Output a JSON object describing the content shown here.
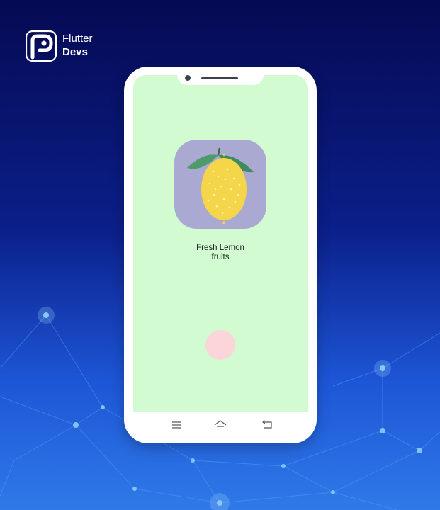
{
  "brand": {
    "line1": "Flutter",
    "line2": "Devs",
    "logo_icon": "flutterdevs-logo-icon"
  },
  "app": {
    "image_icon": "lemon-icon",
    "caption_line1": "Fresh Lemon",
    "caption_line2": "fruits",
    "button_icon": "circle-button-icon"
  },
  "navbar": {
    "items": [
      "menu-icon",
      "home-icon",
      "back-icon"
    ]
  },
  "colors": {
    "screen_bg": "#d2fbd1",
    "icon_card_bg": "#a9a9d2",
    "lemon": "#f5d64a",
    "leaf": "#4f9a6b",
    "circle_button": "#fbd5da"
  }
}
